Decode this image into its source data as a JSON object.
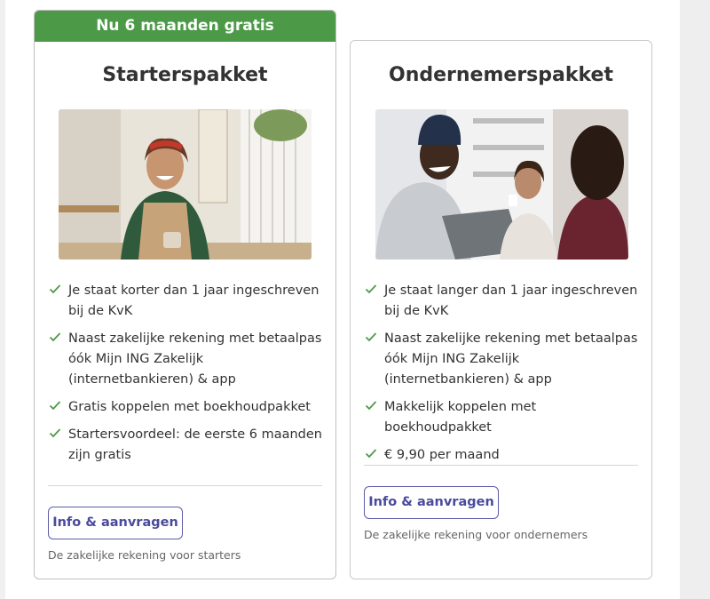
{
  "colors": {
    "accent_green": "#4c9a47",
    "button_purple": "#4a4a9c"
  },
  "cards": [
    {
      "badge": "Nu 6 maanden gratis",
      "title": "Starterspakket",
      "features": [
        "Je staat korter dan 1 jaar ingeschreven bij de KvK",
        "Naast zakelijke rekening met betaalpas óók Mijn ING Zakelijk (internetbankieren) & app",
        "Gratis koppelen met boekhoudpakket",
        "Startersvoordeel: de eerste 6 maanden zijn gratis"
      ],
      "button": "Info & aanvragen",
      "subtext": "De zakelijke rekening voor starters"
    },
    {
      "title": "Ondernemerspakket",
      "features": [
        "Je staat langer dan 1 jaar ingeschreven bij de KvK",
        "Naast zakelijke rekening met betaalpas óók Mijn ING Zakelijk (internetbankieren) & app",
        "Makkelijk koppelen met boekhoudpakket",
        "€ 9,90 per maand"
      ],
      "button": "Info & aanvragen",
      "subtext": "De zakelijke rekening voor ondernemers"
    }
  ]
}
